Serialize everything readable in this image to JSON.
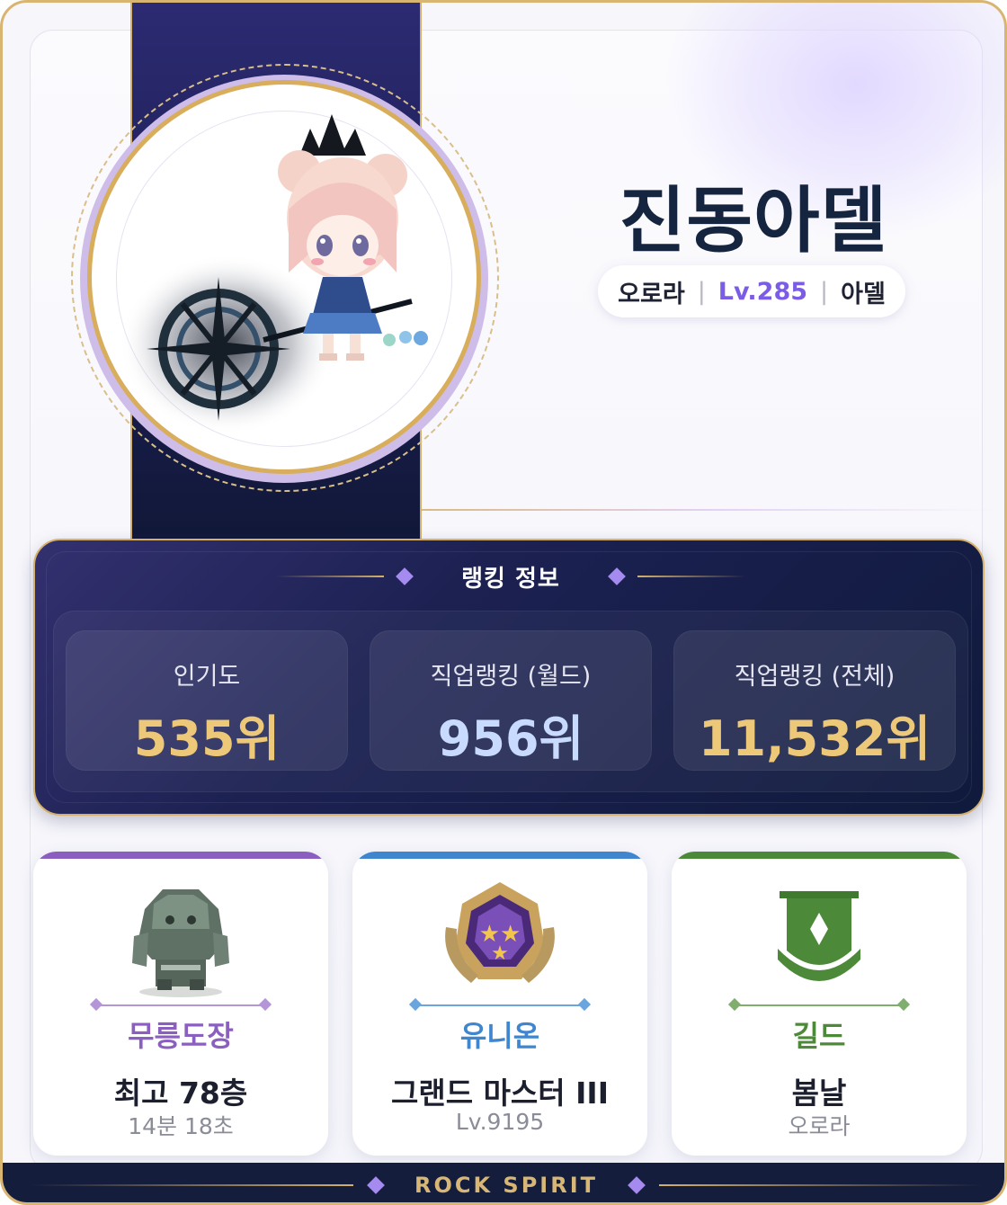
{
  "character": {
    "name": "진동아델",
    "world": "오로라",
    "level": "Lv.285",
    "job": "아델"
  },
  "ranking": {
    "title": "랭킹 정보",
    "items": [
      {
        "label": "인기도",
        "value": "535위"
      },
      {
        "label": "직업랭킹 (월드)",
        "value": "956위"
      },
      {
        "label": "직업랭킹 (전체)",
        "value": "11,532위"
      }
    ]
  },
  "cards": [
    {
      "category": "무릉도장",
      "main": "최고 78층",
      "sub": "14분 18초",
      "icon": "stone-golem-icon",
      "color": "#8b5fc0"
    },
    {
      "category": "유니온",
      "main": "그랜드 마스터 III",
      "sub": "Lv.9195",
      "icon": "union-emblem-icon",
      "color": "#3f86cf"
    },
    {
      "category": "길드",
      "main": "봄날",
      "sub": "오로라",
      "icon": "guild-banner-icon",
      "color": "#4c8a3a"
    }
  ],
  "footer": {
    "text": "ROCK SPIRIT"
  },
  "colors": {
    "gold_border": "#d4b06c",
    "navy": "#1a1f52",
    "level_purple": "#7b5ce6",
    "rank_gold": "#ecc878",
    "rank_blue": "#c8dbff"
  }
}
